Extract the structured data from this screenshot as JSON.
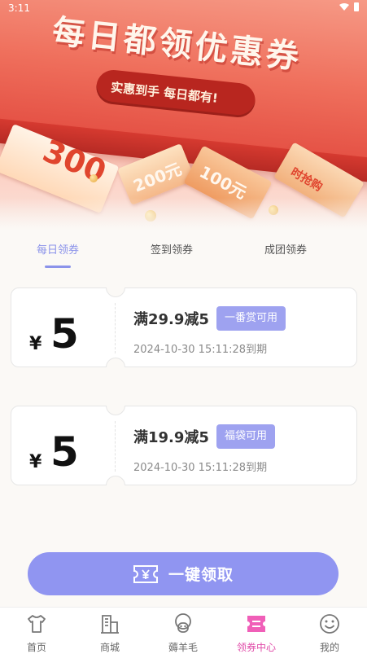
{
  "status_bar": {
    "time": "3:11"
  },
  "banner": {
    "title": "每日都领优惠券",
    "pill_text": "实惠到手  每日都有!",
    "ticket_texts": [
      "300",
      "200元",
      "100元",
      "时抢购"
    ]
  },
  "tabs": [
    {
      "label": "每日领券",
      "active": true
    },
    {
      "label": "签到领券",
      "active": false
    },
    {
      "label": "成团领券",
      "active": false
    }
  ],
  "coupons": [
    {
      "currency": "¥",
      "amount": "5",
      "title": "满29.9减5",
      "tag": "一番赏可用",
      "expiry": "2024-10-30 15:11:28到期"
    },
    {
      "currency": "¥",
      "amount": "5",
      "title": "满19.9减5",
      "tag": "福袋可用",
      "expiry": "2024-10-30 15:11:28到期"
    }
  ],
  "claim_button": {
    "label": "一键领取",
    "icon": "yen-ticket-icon"
  },
  "bottom_nav": [
    {
      "label": "首页",
      "icon": "home-shirt-icon",
      "active": false
    },
    {
      "label": "商城",
      "icon": "building-icon",
      "active": false
    },
    {
      "label": "薅羊毛",
      "icon": "sheep-icon",
      "active": false
    },
    {
      "label": "领券中心",
      "icon": "coupon-icon",
      "active": true
    },
    {
      "label": "我的",
      "icon": "smiley-icon",
      "active": false
    }
  ],
  "colors": {
    "accent": "#8b93ea",
    "button": "#9095f1",
    "tag": "#9ea2f0",
    "nav_active": "#e04aa8",
    "banner_red": "#e24a3f"
  }
}
